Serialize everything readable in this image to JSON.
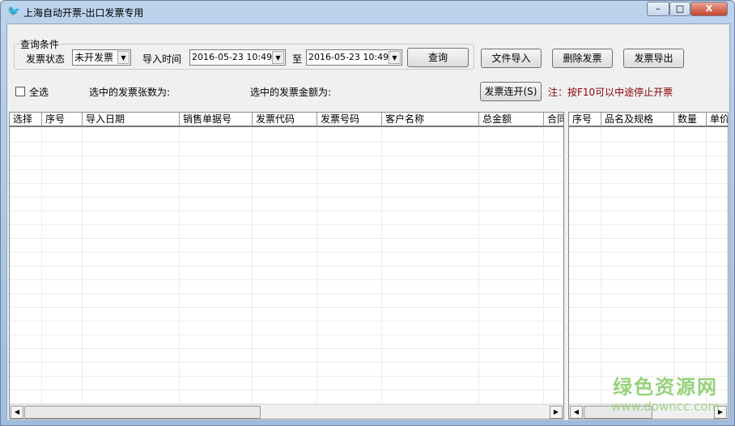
{
  "window": {
    "title": "上海自动开票-出口发票专用",
    "minimize": "–",
    "maximize": "□",
    "close": "X"
  },
  "query": {
    "legend": "查询条件",
    "status_label": "发票状态",
    "status_value": "未开发票",
    "time_label": "导入时间",
    "time_from": "2016-05-23 10:49",
    "to_label": "至",
    "time_to": "2016-05-23 10:49",
    "search_btn": "查询"
  },
  "toolbar": {
    "import": "文件导入",
    "delete": "删除发票",
    "export": "发票导出",
    "batch": "发票连开(S)"
  },
  "selection": {
    "select_all": "全选",
    "count_label": "选中的发票张数为:",
    "amount_label": "选中的发票金额为:",
    "note": "注：按F10可以中途停止开票",
    "note_color": "#8b0000"
  },
  "main_grid": {
    "columns": [
      "选择",
      "序号",
      "导入日期",
      "销售单据号",
      "发票代码",
      "发票号码",
      "客户名称",
      "总金额",
      "合同"
    ]
  },
  "detail_grid": {
    "columns": [
      "序号",
      "品名及规格",
      "数量",
      "单价"
    ]
  },
  "watermark": {
    "cn": "绿色资源网",
    "url": "www.downcc.com"
  }
}
